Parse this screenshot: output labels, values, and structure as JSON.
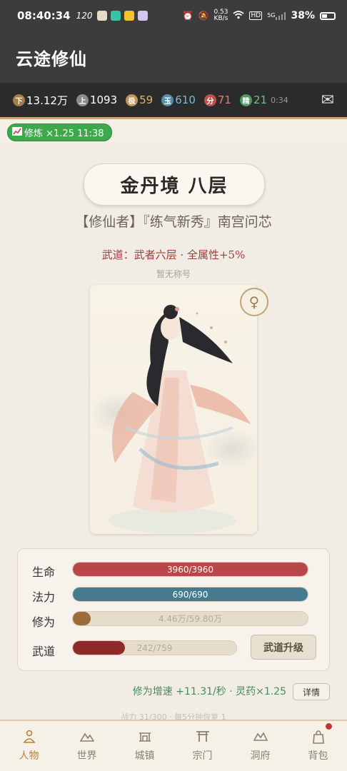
{
  "status_bar": {
    "time": "08:40:34",
    "rate": "120",
    "net_speed_value": "0.53",
    "net_speed_unit": "KB/s",
    "hd_label": "HD",
    "signal_label": "5G",
    "battery": "38%"
  },
  "app": {
    "title": "云途修仙"
  },
  "resources": [
    {
      "icon_char": "下",
      "value": "13.12万",
      "color": "#a57d4b",
      "text_color": "#ffffff"
    },
    {
      "icon_char": "上",
      "value": "1093",
      "color": "#8b8b8b",
      "text_color": "#ffffff"
    },
    {
      "icon_char": "极",
      "value": "59",
      "color": "#c3935d",
      "text_color": "#e0b36a"
    },
    {
      "icon_char": "玉",
      "value": "610",
      "color": "#4f8fa8",
      "text_color": "#7fb6cf"
    },
    {
      "icon_char": "分",
      "value": "71",
      "color": "#c0504d",
      "text_color": "#e07a75"
    },
    {
      "icon_char": "精",
      "value": "21",
      "extra": "0:34",
      "color": "#4f9a63",
      "text_color": "#6fbf82"
    }
  ],
  "mail_icon": "envelope-icon",
  "training_badge": {
    "text": "修炼 ×1.25 11:38"
  },
  "character": {
    "realm": "金丹境 八层",
    "name_line": "【修仙者】『练气新秀』南宫问芯",
    "martial_line": "武道：武者六层 · 全属性+5%",
    "title_line": "暂无称号",
    "gender_symbol": "♀"
  },
  "stats": {
    "hp": {
      "label": "生命",
      "text": "3960/3960",
      "fraction": 1.0,
      "color": "#b9474a"
    },
    "mp": {
      "label": "法力",
      "text": "690/690",
      "fraction": 1.0,
      "color": "#457b8f"
    },
    "cultivation": {
      "label": "修为",
      "text": "4.46万/59.80万",
      "fraction": 0.075,
      "color": "#9b6b3a"
    },
    "martial": {
      "label": "武道",
      "text": "242/759",
      "fraction": 0.32,
      "color": "#8f2a2a"
    },
    "upgrade_label": "武道升级"
  },
  "speed_line": "修为增速 +11.31/秒 · 灵药×1.25",
  "detail_label": "详情",
  "faded_line": "战力 31/300 · 每5分钟恢复 1",
  "nav": [
    {
      "label": "人物",
      "icon": "person-icon",
      "active": true
    },
    {
      "label": "世界",
      "icon": "world-icon",
      "active": false
    },
    {
      "label": "城镇",
      "icon": "town-icon",
      "active": false
    },
    {
      "label": "宗门",
      "icon": "sect-gate-icon",
      "active": false
    },
    {
      "label": "洞府",
      "icon": "cave-icon",
      "active": false
    },
    {
      "label": "背包",
      "icon": "bag-icon",
      "active": false,
      "badge": true
    }
  ]
}
